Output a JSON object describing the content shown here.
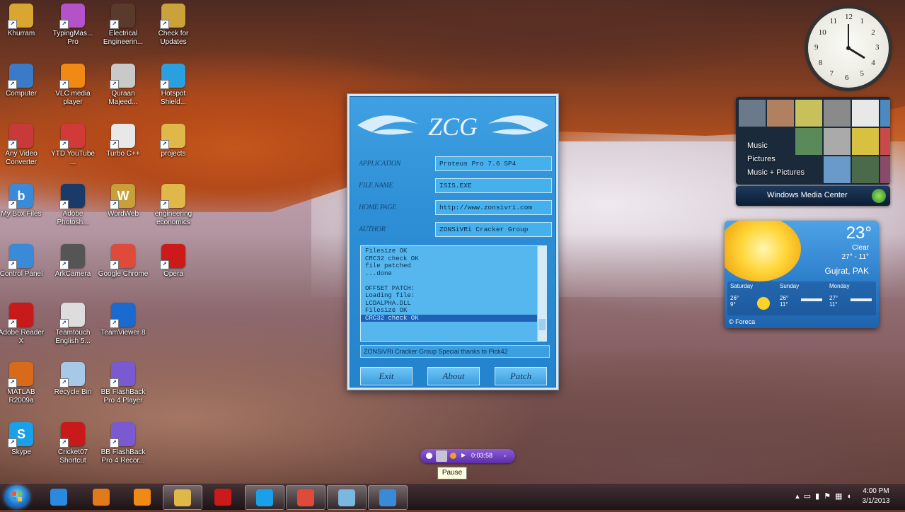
{
  "desktop_icons": [
    {
      "label": "Khurram",
      "color": "#d9a632",
      "glyph": ""
    },
    {
      "label": "TypingMas... Pro",
      "color": "#b453c9",
      "glyph": ""
    },
    {
      "label": "Electrical Engineerin...",
      "color": "#5a3a2a",
      "glyph": ""
    },
    {
      "label": "Check for Updates",
      "color": "#c9a33a",
      "glyph": ""
    },
    {
      "label": "Computer",
      "color": "#3a7ac8",
      "glyph": ""
    },
    {
      "label": "VLC media player",
      "color": "#f08a14",
      "glyph": ""
    },
    {
      "label": "Quraan Majeed...",
      "color": "#c9c9c9",
      "glyph": ""
    },
    {
      "label": "Hotspot Shield...",
      "color": "#2aa0e0",
      "glyph": ""
    },
    {
      "label": "Any Video Converter",
      "color": "#c83a3a",
      "glyph": ""
    },
    {
      "label": "YTD YouTube ...",
      "color": "#d23a3a",
      "glyph": ""
    },
    {
      "label": "Turbo C++",
      "color": "#e8e8e8",
      "glyph": ""
    },
    {
      "label": "projects",
      "color": "#e0b84a",
      "glyph": ""
    },
    {
      "label": "My Box Files",
      "color": "#3a8ad8",
      "glyph": "b"
    },
    {
      "label": "Adobe Photosh...",
      "color": "#1a3a6a",
      "glyph": ""
    },
    {
      "label": "WordWeb",
      "color": "#c8a03a",
      "glyph": "W"
    },
    {
      "label": "engineering economics",
      "color": "#e0b84a",
      "glyph": ""
    },
    {
      "label": "Control Panel",
      "color": "#3a8ad8",
      "glyph": ""
    },
    {
      "label": "ArkCamera",
      "color": "#555555",
      "glyph": ""
    },
    {
      "label": "Google Chrome",
      "color": "#e04a3a",
      "glyph": ""
    },
    {
      "label": "Opera",
      "color": "#cc1a1a",
      "glyph": ""
    },
    {
      "label": "Adobe Reader X",
      "color": "#c81a1a",
      "glyph": ""
    },
    {
      "label": "Teamtouch English 5...",
      "color": "#dddddd",
      "glyph": ""
    },
    {
      "label": "TeamViewer 8",
      "color": "#1a6ad0",
      "glyph": ""
    },
    {
      "label": "",
      "color": "",
      "glyph": ""
    },
    {
      "label": "MATLAB R2009a",
      "color": "#d86a1a",
      "glyph": ""
    },
    {
      "label": "Recycle Bin",
      "color": "#a8c8e8",
      "glyph": ""
    },
    {
      "label": "BB FlashBack Pro 4 Player",
      "color": "#7a5ad0",
      "glyph": ""
    },
    {
      "label": "",
      "color": "",
      "glyph": ""
    },
    {
      "label": "Skype",
      "color": "#1aa0e8",
      "glyph": "S"
    },
    {
      "label": "Cricket07 Shortcut",
      "color": "#c81a1a",
      "glyph": ""
    },
    {
      "label": "BB FlashBack Pro 4 Recor...",
      "color": "#7a5ad0",
      "glyph": ""
    }
  ],
  "clock_gadget": {
    "numbers": [
      "12",
      "1",
      "2",
      "3",
      "4",
      "5",
      "6",
      "7",
      "8",
      "9",
      "10",
      "11"
    ]
  },
  "media_center": {
    "menu": [
      "Music",
      "Pictures",
      "Music + Pictures"
    ],
    "bar_label": "Windows Media Center"
  },
  "weather": {
    "temp": "23°",
    "condition": "Clear",
    "range": "27° - 11°",
    "location": "Gujrat, PAK",
    "days": [
      {
        "name": "Saturday",
        "hi": "26°",
        "lo": "9°"
      },
      {
        "name": "Sunday",
        "hi": "26°",
        "lo": "11°"
      },
      {
        "name": "Monday",
        "hi": "27°",
        "lo": "11°"
      }
    ],
    "footer": "© Foreca"
  },
  "keygen": {
    "logo": "ZCG",
    "rows": [
      {
        "tag": "APPLICATION",
        "value": "Proteus Pro 7.6 SP4"
      },
      {
        "tag": "FILE NAME",
        "value": "ISIS.EXE"
      },
      {
        "tag": "HOME PAGE",
        "value": "http://www.zonsivri.com"
      },
      {
        "tag": "AUTHOR",
        "value": "ZONSiVRi Cracker Group"
      }
    ],
    "log": [
      "Filesize OK",
      "CRC32 check OK",
      "file patched",
      "...done",
      "",
      "OFFSET PATCH:",
      "Loading file:",
      "LCDALPHA.DLL",
      "Filesize OK",
      "CRC32 check OK"
    ],
    "status": "ZONSiVRi Cracker Group   Special thanks to Pick42",
    "buttons": {
      "exit": "Exit",
      "about": "About",
      "patch": "Patch"
    }
  },
  "mini_player": {
    "time": "0:03:58"
  },
  "tooltip": "Pause",
  "taskbar": {
    "apps": [
      {
        "name": "internet-explorer",
        "color": "#2a8ae0",
        "active": false
      },
      {
        "name": "media-player",
        "color": "#e07a1a",
        "active": false
      },
      {
        "name": "vlc",
        "color": "#f08a14",
        "active": false
      },
      {
        "name": "explorer",
        "color": "#e0b84a",
        "active": true
      },
      {
        "name": "opera",
        "color": "#cc1a1a",
        "active": false
      },
      {
        "name": "skype",
        "color": "#1aa0e8",
        "active": true
      },
      {
        "name": "chrome",
        "color": "#e04a3a",
        "active": true
      },
      {
        "name": "unknown-app",
        "color": "#7ab8e0",
        "active": true
      },
      {
        "name": "keygen",
        "color": "#3a8ad8",
        "active": true
      }
    ],
    "time": "4:00 PM",
    "date": "3/1/2013"
  }
}
